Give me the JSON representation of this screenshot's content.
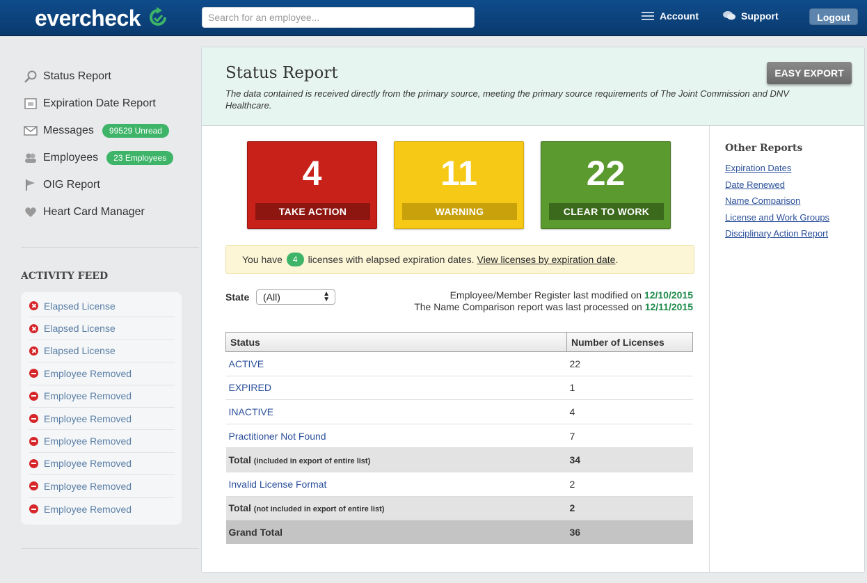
{
  "header": {
    "logo_text": "evercheck",
    "search_placeholder": "Search for an employee...",
    "account_label": "Account",
    "support_label": "Support",
    "logout_label": "Logout"
  },
  "sidebar": {
    "items": [
      {
        "label": "Status Report",
        "icon": "magnifier-icon"
      },
      {
        "label": "Expiration Date Report",
        "icon": "calendar-icon"
      },
      {
        "label": "Messages",
        "icon": "envelope-icon",
        "badge": "99529 Unread"
      },
      {
        "label": "Employees",
        "icon": "people-icon",
        "badge": "23 Employees"
      },
      {
        "label": "OIG Report",
        "icon": "flag-icon"
      },
      {
        "label": "Heart Card Manager",
        "icon": "heart-icon"
      }
    ]
  },
  "activity_feed": {
    "title": "ACTIVITY FEED",
    "items": [
      {
        "label": "Elapsed License",
        "icon": "x-circle-icon"
      },
      {
        "label": "Elapsed License",
        "icon": "x-circle-icon"
      },
      {
        "label": "Elapsed License",
        "icon": "x-circle-icon"
      },
      {
        "label": "Employee Removed",
        "icon": "minus-circle-icon"
      },
      {
        "label": "Employee Removed",
        "icon": "minus-circle-icon"
      },
      {
        "label": "Employee Removed",
        "icon": "minus-circle-icon"
      },
      {
        "label": "Employee Removed",
        "icon": "minus-circle-icon"
      },
      {
        "label": "Employee Removed",
        "icon": "minus-circle-icon"
      },
      {
        "label": "Employee Removed",
        "icon": "minus-circle-icon"
      },
      {
        "label": "Employee Removed",
        "icon": "minus-circle-icon"
      }
    ]
  },
  "main": {
    "title": "Status Report",
    "subtitle": "The data contained is received directly from the primary source, meeting the primary source requirements of The Joint Commission and DNV Healthcare.",
    "export_label": "EASY EXPORT",
    "tiles": [
      {
        "count": "4",
        "label": "TAKE ACTION",
        "color": "#c8211a"
      },
      {
        "count": "11",
        "label": "WARNING",
        "color": "#f5c916"
      },
      {
        "count": "22",
        "label": "CLEAR TO WORK",
        "color": "#5b9a2e"
      }
    ],
    "alert": {
      "prefix": "You have",
      "count": "4",
      "middle": "licenses with elapsed expiration dates.",
      "link": "View licenses by expiration date",
      "suffix": "."
    },
    "filter": {
      "state_label": "State",
      "state_value": "(All)"
    },
    "modified": {
      "line1_label": "Employee/Member Register last modified on",
      "line1_date": "12/10/2015",
      "line2_label": "The Name Comparison report was last processed on",
      "line2_date": "12/11/2015"
    },
    "table": {
      "headers": [
        "Status",
        "Number of Licenses"
      ],
      "rows": [
        {
          "status": "ACTIVE",
          "count": "22"
        },
        {
          "status": "EXPIRED",
          "count": "1"
        },
        {
          "status": "INACTIVE",
          "count": "4"
        },
        {
          "status": "Practitioner Not Found",
          "count": "7"
        },
        {
          "status": "Total",
          "note": "(included in export of entire list)",
          "count": "34"
        },
        {
          "status": "Invalid License Format",
          "count": "2"
        },
        {
          "status": "Total",
          "note": "(not included in export of entire list)",
          "count": "2"
        },
        {
          "status": "Grand Total",
          "count": "36"
        }
      ]
    }
  },
  "other_reports": {
    "title": "Other Reports",
    "links": [
      "Expiration Dates",
      "Date Renewed",
      "Name Comparison",
      "License and Work Groups",
      "Disciplinary Action Report"
    ]
  },
  "colors": {
    "topbar": "#0f4c8c",
    "badge_green": "#3eb468",
    "link_blue": "#2a4f9a",
    "header_mint": "#e7f5f1"
  }
}
